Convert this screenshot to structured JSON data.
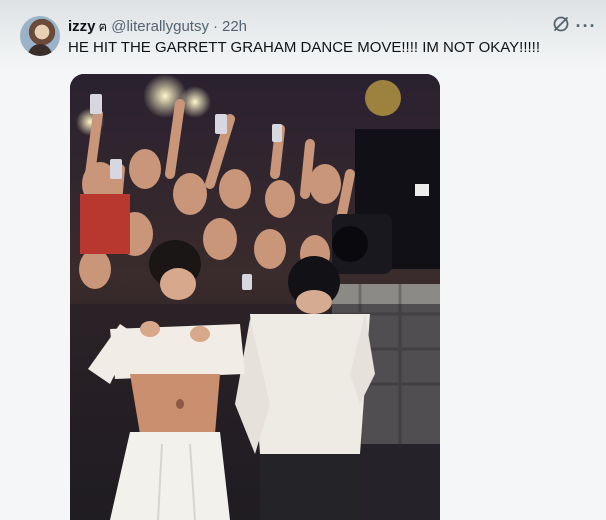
{
  "tweet": {
    "author": {
      "display_name": "izzy",
      "name_badge": "ฅ",
      "handle": "@literallygutsy",
      "separator": "·",
      "time": "22h"
    },
    "text": "HE HIT THE GARRETT GRAHAM DANCE MOVE!!!! IM NOT OKAY!!!!!",
    "actions": {
      "grok_icon": "grok-icon",
      "more_label": "···"
    },
    "media": {
      "type": "video-still",
      "icon": "video-media"
    }
  }
}
